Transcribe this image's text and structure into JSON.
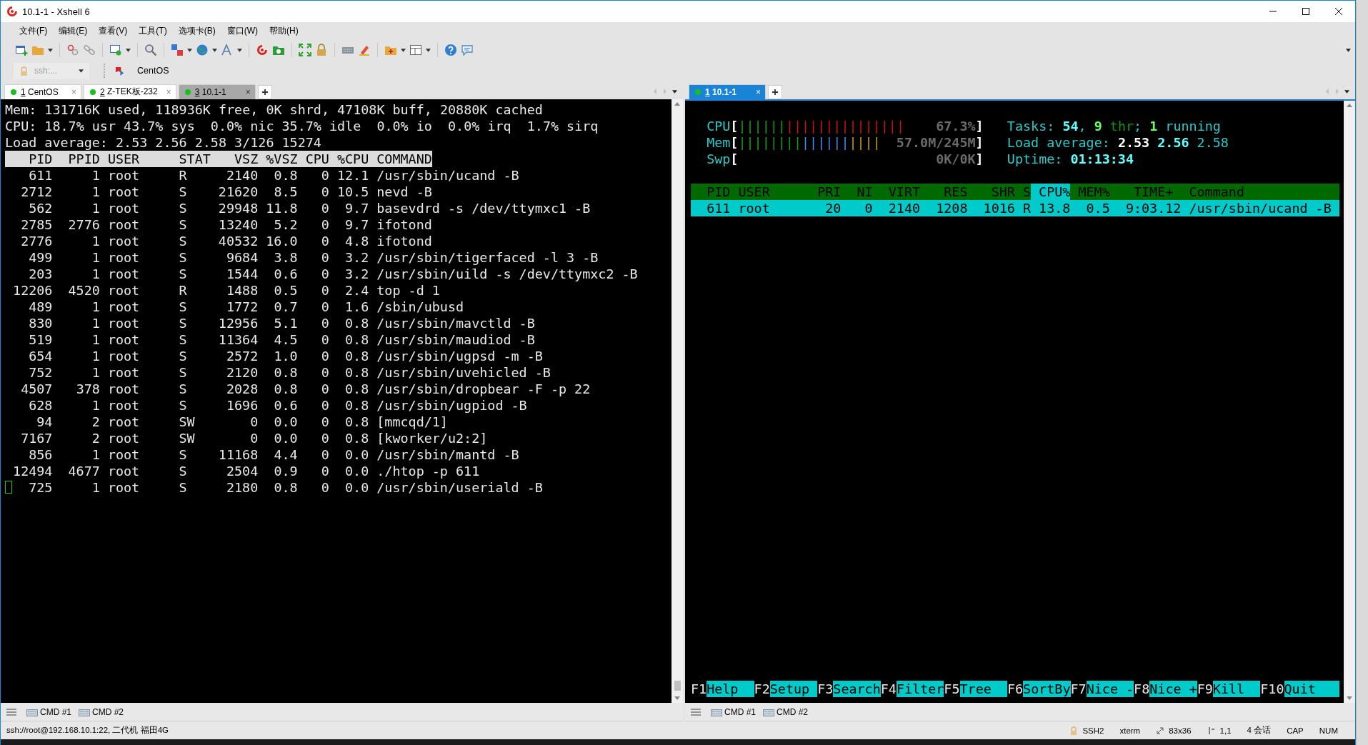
{
  "window": {
    "title": "10.1-1 - Xshell 6"
  },
  "menu": [
    "文件(F)",
    "编辑(E)",
    "查看(V)",
    "工具(T)",
    "选项卡(B)",
    "窗口(W)",
    "帮助(H)"
  ],
  "address_bar": {
    "session": "ssh:...",
    "link": "CentOS"
  },
  "left_pane": {
    "tabs": [
      {
        "number": "1",
        "label": "CentOS",
        "close": "×",
        "selected": false
      },
      {
        "number": "2",
        "label": "Z-TEK板-232",
        "close": "×",
        "selected": false
      },
      {
        "number": "3",
        "label": "10.1-1",
        "close": "×",
        "selected": true
      }
    ],
    "terminal": {
      "summary": [
        "Mem: 131716K used, 118936K free, 0K shrd, 47108K buff, 20880K cached",
        "CPU: 18.7% usr 43.7% sys  0.0% nic 35.7% idle  0.0% io  0.0% irq  1.7% sirq",
        "Load average: 2.53 2.56 2.58 3/126 15274"
      ],
      "columns": [
        "PID",
        "PPID",
        "USER",
        "STAT",
        "VSZ",
        "%VSZ",
        "CPU",
        "%CPU",
        "COMMAND"
      ],
      "rows": [
        {
          "cells": [
            "611",
            "1",
            "root",
            "R",
            "2140",
            "0.8",
            "0",
            "12.1",
            "/usr/sbin/ucand -B"
          ],
          "cursor": false
        },
        {
          "cells": [
            "2712",
            "1",
            "root",
            "S",
            "21620",
            "8.5",
            "0",
            "10.5",
            "nevd -B"
          ],
          "cursor": false
        },
        {
          "cells": [
            "562",
            "1",
            "root",
            "S",
            "29948",
            "11.8",
            "0",
            "9.7",
            "basevdrd -s /dev/ttymxc1 -B"
          ],
          "cursor": false
        },
        {
          "cells": [
            "2785",
            "2776",
            "root",
            "S",
            "13240",
            "5.2",
            "0",
            "9.7",
            "ifotond"
          ],
          "cursor": false
        },
        {
          "cells": [
            "2776",
            "1",
            "root",
            "S",
            "40532",
            "16.0",
            "0",
            "4.8",
            "ifotond"
          ],
          "cursor": false
        },
        {
          "cells": [
            "499",
            "1",
            "root",
            "S",
            "9684",
            "3.8",
            "0",
            "3.2",
            "/usr/sbin/tigerfaced -l 3 -B"
          ],
          "cursor": false
        },
        {
          "cells": [
            "203",
            "1",
            "root",
            "S",
            "1544",
            "0.6",
            "0",
            "3.2",
            "/usr/sbin/uild -s /dev/ttymxc2 -B"
          ],
          "cursor": false
        },
        {
          "cells": [
            "12206",
            "4520",
            "root",
            "R",
            "1488",
            "0.5",
            "0",
            "2.4",
            "top -d 1"
          ],
          "cursor": false
        },
        {
          "cells": [
            "489",
            "1",
            "root",
            "S",
            "1772",
            "0.7",
            "0",
            "1.6",
            "/sbin/ubusd"
          ],
          "cursor": false
        },
        {
          "cells": [
            "830",
            "1",
            "root",
            "S",
            "12956",
            "5.1",
            "0",
            "0.8",
            "/usr/sbin/mavctld -B"
          ],
          "cursor": false
        },
        {
          "cells": [
            "519",
            "1",
            "root",
            "S",
            "11364",
            "4.5",
            "0",
            "0.8",
            "/usr/sbin/maudiod -B"
          ],
          "cursor": false
        },
        {
          "cells": [
            "654",
            "1",
            "root",
            "S",
            "2572",
            "1.0",
            "0",
            "0.8",
            "/usr/sbin/ugpsd -m -B"
          ],
          "cursor": false
        },
        {
          "cells": [
            "752",
            "1",
            "root",
            "S",
            "2120",
            "0.8",
            "0",
            "0.8",
            "/usr/sbin/uvehicled -B"
          ],
          "cursor": false
        },
        {
          "cells": [
            "4507",
            "378",
            "root",
            "S",
            "2028",
            "0.8",
            "0",
            "0.8",
            "/usr/sbin/dropbear -F -p 22"
          ],
          "cursor": false
        },
        {
          "cells": [
            "628",
            "1",
            "root",
            "S",
            "1696",
            "0.6",
            "0",
            "0.8",
            "/usr/sbin/ugpiod -B"
          ],
          "cursor": false
        },
        {
          "cells": [
            "94",
            "2",
            "root",
            "SW",
            "0",
            "0.0",
            "0",
            "0.8",
            "[mmcqd/1]"
          ],
          "cursor": false
        },
        {
          "cells": [
            "7167",
            "2",
            "root",
            "SW",
            "0",
            "0.0",
            "0",
            "0.8",
            "[kworker/u2:2]"
          ],
          "cursor": false
        },
        {
          "cells": [
            "856",
            "1",
            "root",
            "S",
            "11168",
            "4.4",
            "0",
            "0.0",
            "/usr/sbin/mantd -B"
          ],
          "cursor": false
        },
        {
          "cells": [
            "12494",
            "4677",
            "root",
            "S",
            "2504",
            "0.9",
            "0",
            "0.0",
            "./htop -p 611"
          ],
          "cursor": false
        },
        {
          "cells": [
            "725",
            "1",
            "root",
            "S",
            "2180",
            "0.8",
            "0",
            "0.0",
            "/usr/sbin/useriald -B"
          ],
          "cursor": true
        }
      ]
    },
    "command_tabs": [
      "CMD #1",
      "CMD #2"
    ]
  },
  "right_pane": {
    "tabs": [
      {
        "number": "1",
        "label": "10.1-1",
        "close": "×",
        "selected": true
      }
    ],
    "htop": {
      "meters": [
        {
          "label": "CPU",
          "open": "[",
          "segments": [
            {
              "text": "||||||",
              "color": "#10a010"
            },
            {
              "text": "|||||||||||||||",
              "color": "#d01010"
            }
          ],
          "reading": "67.3%",
          "close": "]"
        },
        {
          "label": "Mem",
          "open": "[",
          "segments": [
            {
              "text": "||||||||",
              "color": "#10a010"
            },
            {
              "text": "||||||",
              "color": "#3a8cff"
            },
            {
              "text": "||||",
              "color": "#c8a000"
            }
          ],
          "reading": "57.0M/245M",
          "close": "]"
        },
        {
          "label": "Swp",
          "open": "[",
          "reading": "0K/0K",
          "close": "]"
        }
      ],
      "info": [
        [
          {
            "text": "Tasks: ",
            "kind": "label"
          },
          {
            "text": "54",
            "kind": "value"
          },
          {
            "text": ", ",
            "kind": "label"
          },
          {
            "text": "9",
            "kind": "count"
          },
          {
            "text": " thr",
            "kind": "dim"
          },
          {
            "text": "; ",
            "kind": "label"
          },
          {
            "text": "1",
            "kind": "count"
          },
          {
            "text": " running",
            "kind": "label"
          }
        ],
        [
          {
            "text": "Load average: ",
            "kind": "label"
          },
          {
            "text": "2.53",
            "kind": "strong"
          },
          {
            "text": " 2.56",
            "kind": "value"
          },
          {
            "text": " 2.58",
            "kind": "label"
          }
        ],
        [
          {
            "text": "Uptime: ",
            "kind": "label"
          },
          {
            "text": "01:13:34",
            "kind": "value"
          }
        ]
      ],
      "columns": [
        {
          "label": "PID",
          "selected": false
        },
        {
          "label": "USER",
          "selected": false
        },
        {
          "label": "PRI",
          "selected": false
        },
        {
          "label": "NI",
          "selected": false
        },
        {
          "label": "VIRT",
          "selected": false
        },
        {
          "label": "RES",
          "selected": false
        },
        {
          "label": "SHR",
          "selected": false
        },
        {
          "label": "S",
          "selected": false
        },
        {
          "label": "CPU%",
          "selected": true
        },
        {
          "label": "MEM%",
          "selected": false
        },
        {
          "label": "TIME+",
          "selected": false
        },
        {
          "label": "Command",
          "selected": false
        }
      ],
      "rows": [
        {
          "cells": [
            "611",
            "root",
            "20",
            "0",
            "2140",
            "1208",
            "1016",
            "R",
            "13.8",
            "0.5",
            "9:03.12",
            "/usr/sbin/ucand -B"
          ],
          "selected": true
        }
      ],
      "function_keys": [
        {
          "key": "F1",
          "label": "Help"
        },
        {
          "key": "F2",
          "label": "Setup"
        },
        {
          "key": "F3",
          "label": "Search"
        },
        {
          "key": "F4",
          "label": "Filter"
        },
        {
          "key": "F5",
          "label": "Tree"
        },
        {
          "key": "F6",
          "label": "SortBy"
        },
        {
          "key": "F7",
          "label": "Nice -"
        },
        {
          "key": "F8",
          "label": "Nice +"
        },
        {
          "key": "F9",
          "label": "Kill"
        },
        {
          "key": "F10",
          "label": "Quit"
        }
      ]
    },
    "command_tabs": [
      "CMD #1",
      "CMD #2"
    ]
  },
  "status_bar": {
    "connection": "ssh://root@192.168.10.1:22, 二代机 福田4G",
    "items": [
      "SSH2",
      "xterm",
      "83x36",
      "1,1",
      "4 会话",
      "CAP",
      "NUM"
    ]
  }
}
